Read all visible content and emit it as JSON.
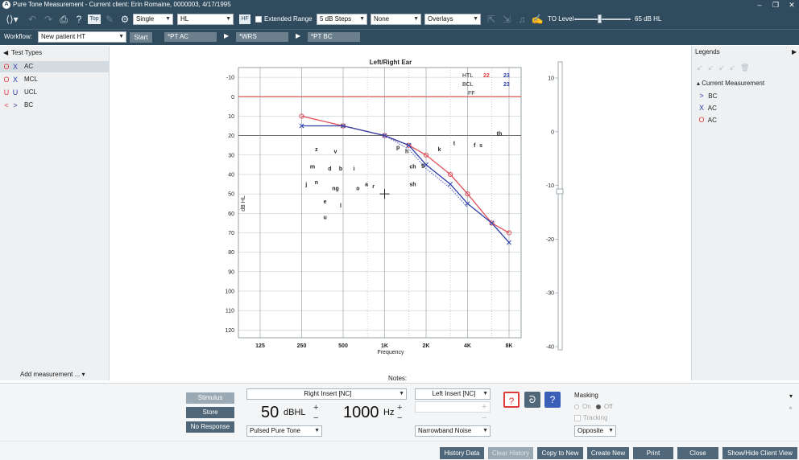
{
  "app": {
    "title": "Pure Tone Measurement - Current client: Erin Romaine, 0000003, 4/17/1995",
    "logo_letter": "A"
  },
  "toolbar": {
    "mode_select": "Single",
    "scale_select": "HL",
    "hf_label": "HF",
    "extended_range_label": "Extended Range",
    "step_select": "5 dB Steps",
    "none_select": "None",
    "overlays_select": "Overlays",
    "to_level_label": "TO Level",
    "to_level_value": "65 dB HL",
    "to_level_fraction": 0.45
  },
  "workflow": {
    "label": "Workflow:",
    "select": "New patient HT",
    "start_label": "Start",
    "steps": [
      "*PT AC",
      "*WRS",
      "*PT BC"
    ]
  },
  "test_types": {
    "header": "Test Types",
    "items": [
      {
        "sym1": "O",
        "sym2": "X",
        "label": "AC",
        "color1": "#e03b3b",
        "color2": "#2d3ea8",
        "active": true
      },
      {
        "sym1": "O",
        "sym2": "X",
        "label": "MCL",
        "color1": "#e03b3b",
        "color2": "#2d3ea8",
        "active": false
      },
      {
        "sym1": "U",
        "sym2": "U",
        "label": "UCL",
        "color1": "#e03b3b",
        "color2": "#2d3ea8",
        "active": false
      },
      {
        "sym1": "<",
        "sym2": ">",
        "label": "BC",
        "color1": "#e03b3b",
        "color2": "#2d3ea8",
        "active": false
      }
    ],
    "add_measurement": "Add measurement ..."
  },
  "chart_data": {
    "type": "line",
    "title": "Left/Right Ear",
    "xlabel": "Frequency",
    "ylabel": "dB HL",
    "x_ticks": [
      "125",
      "250",
      "500",
      "1K",
      "2K",
      "4K",
      "8K"
    ],
    "y_ticks": [
      -10,
      0,
      10,
      20,
      30,
      40,
      50,
      60,
      70,
      80,
      90,
      100,
      110,
      120
    ],
    "ylim": [
      -15,
      124
    ],
    "series": [
      {
        "name": "AC",
        "ear": "right",
        "color": "#e0505a",
        "x": [
          250,
          500,
          1000,
          1500,
          2000,
          3000,
          4000,
          6000,
          8000
        ],
        "y": [
          10,
          15,
          20,
          25,
          30,
          40,
          50,
          65,
          70
        ]
      },
      {
        "name": "AC",
        "ear": "left",
        "color": "#2d3ea8",
        "x": [
          250,
          500,
          1000,
          1500,
          2000,
          3000,
          4000,
          6000,
          8000
        ],
        "y": [
          15,
          15,
          20,
          25,
          35,
          45,
          55,
          65,
          75
        ]
      },
      {
        "name": "BC",
        "ear": "left",
        "color": "#4a59c4",
        "dotted": true,
        "x": [
          1000,
          1500,
          2000,
          3000,
          4000
        ],
        "y": [
          20,
          27,
          37,
          47,
          57
        ]
      }
    ],
    "htl_labels": {
      "htl": "HTL",
      "bcl": "BCL",
      "ff": "FF",
      "htl_right": "22",
      "htl_left": "23",
      "bcl_left": "23"
    },
    "speech_letters": [
      {
        "t": "z",
        "x": 320,
        "y": 28
      },
      {
        "t": "v",
        "x": 440,
        "y": 29
      },
      {
        "t": "p",
        "x": 1250,
        "y": 27
      },
      {
        "t": "h",
        "x": 1450,
        "y": 29
      },
      {
        "t": "k",
        "x": 2500,
        "y": 28
      },
      {
        "t": "t",
        "x": 3200,
        "y": 25
      },
      {
        "t": "f",
        "x": 4500,
        "y": 26
      },
      {
        "t": "s",
        "x": 5000,
        "y": 26
      },
      {
        "t": "th",
        "x": 6800,
        "y": 20
      },
      {
        "t": "m",
        "x": 300,
        "y": 37
      },
      {
        "t": "d",
        "x": 400,
        "y": 38
      },
      {
        "t": "b",
        "x": 480,
        "y": 38
      },
      {
        "t": "i",
        "x": 600,
        "y": 38
      },
      {
        "t": "ch",
        "x": 1600,
        "y": 37
      },
      {
        "t": "g",
        "x": 1900,
        "y": 36
      },
      {
        "t": "j",
        "x": 270,
        "y": 46
      },
      {
        "t": "n",
        "x": 320,
        "y": 45
      },
      {
        "t": "ng",
        "x": 440,
        "y": 48
      },
      {
        "t": "o",
        "x": 640,
        "y": 48
      },
      {
        "t": "a",
        "x": 740,
        "y": 46
      },
      {
        "t": "r",
        "x": 830,
        "y": 47
      },
      {
        "t": "sh",
        "x": 1600,
        "y": 46
      },
      {
        "t": "e",
        "x": 370,
        "y": 55
      },
      {
        "t": "l",
        "x": 480,
        "y": 57
      },
      {
        "t": "u",
        "x": 370,
        "y": 63
      }
    ],
    "banana_upper": [
      [
        200,
        11
      ],
      [
        250,
        17
      ],
      [
        500,
        29
      ],
      [
        1000,
        31
      ],
      [
        2000,
        27
      ],
      [
        4000,
        23
      ],
      [
        8000,
        19
      ]
    ],
    "banana_lower": [
      [
        200,
        36
      ],
      [
        250,
        45
      ],
      [
        500,
        58
      ],
      [
        1000,
        64
      ],
      [
        2000,
        63
      ],
      [
        4000,
        57
      ],
      [
        8000,
        40
      ]
    ],
    "crosshair": {
      "x": 1000,
      "y": 50
    }
  },
  "masking_scale": {
    "ticks": [
      "10",
      "0",
      "-10",
      "-20",
      "-30",
      "-40"
    ]
  },
  "legends": {
    "header": "Legends",
    "section": "Current Measurement",
    "items": [
      {
        "sym": ">",
        "label": "BC",
        "color": "#2d3ea8"
      },
      {
        "sym": "X",
        "label": "AC",
        "color": "#2d3ea8"
      },
      {
        "sym": "O",
        "label": "AC",
        "color": "#e03b3b"
      }
    ]
  },
  "stimulus": {
    "notes_label": "Notes:",
    "stimulus_btn": "Stimulus",
    "store_btn": "Store",
    "no_response_btn": "No Response",
    "right_transducer": "Right Insert [NC]",
    "left_transducer": "Left Insert [NC]",
    "level_value": "50",
    "level_unit": "dBHL",
    "freq_value": "1000",
    "freq_unit": "Hz",
    "stim_type": "Pulsed Pure Tone",
    "noise_type": "Narrowband Noise",
    "plus": "+",
    "minus": "−",
    "masking_label": "Masking",
    "masking_on": "On",
    "masking_off": "Off",
    "tracking_label": "Tracking",
    "masking_mode": "Opposite"
  },
  "footer": {
    "buttons": [
      "History Data",
      "Clear History",
      "Copy to New",
      "Create New",
      "Print",
      "Close",
      "Show/Hide Client View"
    ]
  }
}
